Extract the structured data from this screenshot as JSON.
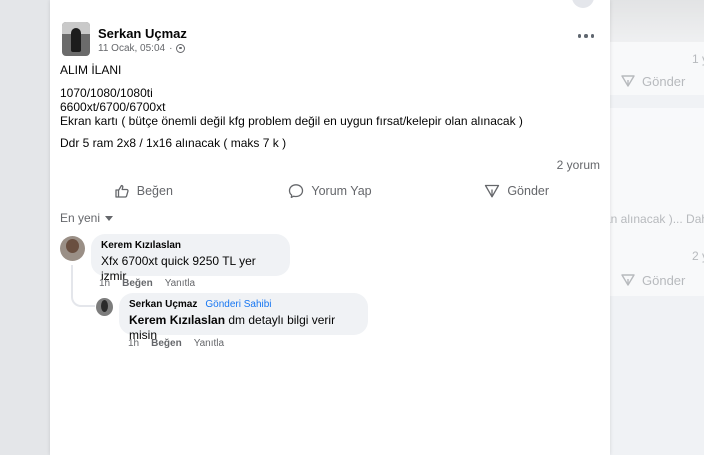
{
  "background_feed": {
    "send_label": "Gönder",
    "snippet_count_1": "1 y",
    "snippet_text": "an alınacak )... Dah",
    "snippet_count_2": "2 y"
  },
  "post": {
    "author": "Serkan Uçmaz",
    "timestamp": "11 Ocak, 05:04",
    "lines": [
      "ALIM İLANI",
      "1070/1080/1080ti",
      "6600xt/6700/6700xt",
      "Ekran kartı ( bütçe önemli değil kfg problem değil en uygun fırsat/kelepir olan alınacak )",
      "Ddr 5 ram 2x8 / 1x16  alınacak ( maks 7 k )"
    ],
    "comment_count": "2 yorum",
    "actions": {
      "like": "Beğen",
      "comment": "Yorum Yap",
      "send": "Gönder"
    },
    "sort_label": "En yeni"
  },
  "comments": [
    {
      "name": "Kerem Kızılaslan",
      "text": "Xfx 6700xt quick 9250 TL yer izmir",
      "time": "1h",
      "like": "Beğen",
      "reply": "Yanıtla"
    },
    {
      "name": "Serkan Uçmaz",
      "badge": "Gönderi Sahibi",
      "mention": "Kerem Kızılaslan",
      "text": " dm detaylı bilgi verir misin",
      "time": "1h",
      "like": "Beğen",
      "reply": "Yanıtla"
    }
  ],
  "icons": [
    "like-icon",
    "comment-icon",
    "send-icon",
    "globe-icon",
    "more-icon",
    "sort-caret-icon"
  ],
  "colors": {
    "link": "#1877f2",
    "muted": "#65676b",
    "bubble": "#f0f2f5"
  }
}
